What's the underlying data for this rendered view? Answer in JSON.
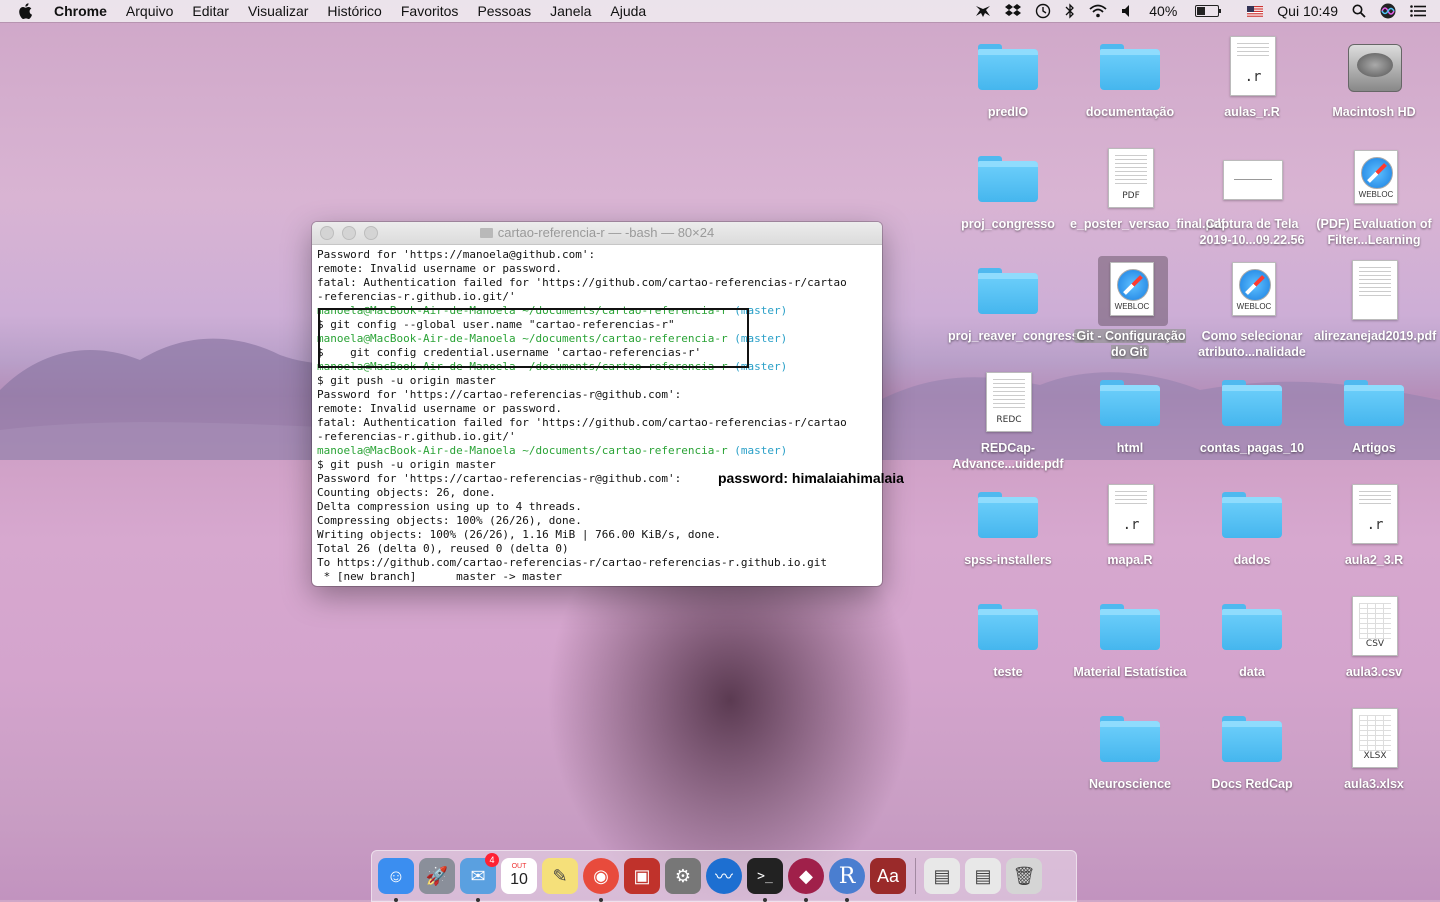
{
  "menubar": {
    "app": "Chrome",
    "items": [
      "Arquivo",
      "Editar",
      "Visualizar",
      "Histórico",
      "Favoritos",
      "Pessoas",
      "Janela",
      "Ajuda"
    ],
    "battery_percent": "40%",
    "battery_level": 0.4,
    "clock": "Qui 10:49"
  },
  "desktop": {
    "icons": [
      {
        "label": "predIO",
        "type": "folder"
      },
      {
        "label": "documentação",
        "type": "folder"
      },
      {
        "label": "aulas_r.R",
        "type": "r-file",
        "ext": ".r"
      },
      {
        "label": "Macintosh HD",
        "type": "drive"
      },
      {
        "label": "proj_congresso",
        "type": "folder"
      },
      {
        "label": "e_poster_versao_final.pdf",
        "type": "pdf",
        "ext": "PDF"
      },
      {
        "label": "Captura de Tela 2019-10...09.22.56",
        "type": "image"
      },
      {
        "label": "(PDF) Evaluation of Filter...Learning",
        "type": "webloc",
        "ext": "WEBLOC"
      },
      {
        "label": "proj_reaver_congresso",
        "type": "folder"
      },
      {
        "label": "Git - Configuração do Git",
        "type": "webloc",
        "ext": "WEBLOC"
      },
      {
        "label": "Como selecionar atributo...nalidade",
        "type": "webloc",
        "ext": "WEBLOC"
      },
      {
        "label": "alirezanejad2019.pdf",
        "type": "pdf"
      },
      {
        "label": "REDCap-Advance...uide.pdf",
        "type": "pdf",
        "ext": "REDC"
      },
      {
        "label": "html",
        "type": "folder"
      },
      {
        "label": "contas_pagas_10",
        "type": "folder"
      },
      {
        "label": "Artigos",
        "type": "folder"
      },
      {
        "label": "spss-installers",
        "type": "folder"
      },
      {
        "label": "mapa.R",
        "type": "r-file",
        "ext": ".r"
      },
      {
        "label": "dados",
        "type": "folder"
      },
      {
        "label": "aula2_3.R",
        "type": "r-file",
        "ext": ".r"
      },
      {
        "label": "teste",
        "type": "folder"
      },
      {
        "label": "Material Estatística",
        "type": "folder"
      },
      {
        "label": "data",
        "type": "folder"
      },
      {
        "label": "aula3.csv",
        "type": "csv",
        "ext": "CSV"
      },
      {
        "label": "Neuroscience",
        "type": "folder"
      },
      {
        "label": "Docs RedCap",
        "type": "folder"
      },
      {
        "label": "aula3.xlsx",
        "type": "xlsx",
        "ext": "XLSX"
      }
    ]
  },
  "terminal": {
    "title": "cartao-referencia-r — -bash — 80×24",
    "lines": [
      {
        "text": "Password for 'https://manoela@github.com':",
        "style": ""
      },
      {
        "text": "remote: Invalid username or password.",
        "style": ""
      },
      {
        "text": "fatal: Authentication failed for 'https://github.com/cartao-referencias-r/cartao",
        "style": ""
      },
      {
        "text": "-referencias-r.github.io.git/'",
        "style": ""
      },
      {
        "text": "manoela@MacBook-Air-de-Manoela ~/documents/cartao-referencia-r (master)",
        "style": "prompt"
      },
      {
        "text": "$ git config --global user.name \"cartao-referencias-r\"",
        "style": ""
      },
      {
        "text": "manoela@MacBook-Air-de-Manoela ~/documents/cartao-referencia-r (master)",
        "style": "prompt"
      },
      {
        "text": "$    git config credential.username 'cartao-referencias-r'",
        "style": ""
      },
      {
        "text": "manoela@MacBook-Air-de-Manoela ~/documents/cartao-referencia-r (master)",
        "style": "prompt"
      },
      {
        "text": "$ git push -u origin master",
        "style": ""
      },
      {
        "text": "Password for 'https://cartao-referencias-r@github.com':",
        "style": ""
      },
      {
        "text": "remote: Invalid username or password.",
        "style": ""
      },
      {
        "text": "fatal: Authentication failed for 'https://github.com/cartao-referencias-r/cartao",
        "style": ""
      },
      {
        "text": "-referencias-r.github.io.git/'",
        "style": ""
      },
      {
        "text": "manoela@MacBook-Air-de-Manoela ~/documents/cartao-referencia-r (master)",
        "style": "prompt"
      },
      {
        "text": "$ git push -u origin master",
        "style": ""
      },
      {
        "text": "Password for 'https://cartao-referencias-r@github.com':",
        "style": ""
      },
      {
        "text": "Counting objects: 26, done.",
        "style": ""
      },
      {
        "text": "Delta compression using up to 4 threads.",
        "style": ""
      },
      {
        "text": "Compressing objects: 100% (26/26), done.",
        "style": ""
      },
      {
        "text": "Writing objects: 100% (26/26), 1.16 MiB | 766.00 KiB/s, done.",
        "style": ""
      },
      {
        "text": "Total 26 (delta 0), reused 0 (delta 0)",
        "style": ""
      },
      {
        "text": "To https://github.com/cartao-referencias-r/cartao-referencias-r.github.io.git",
        "style": ""
      },
      {
        "text": " * [new branch]      master -> master",
        "style": ""
      }
    ],
    "annotation": "password: himalaiahimalaia"
  },
  "dock": {
    "items": [
      {
        "name": "finder",
        "glyph": "☺",
        "color": "#3b8ef0",
        "running": true
      },
      {
        "name": "launchpad",
        "glyph": "🚀",
        "color": "#8a8f9a",
        "running": false
      },
      {
        "name": "mail",
        "glyph": "✉",
        "color": "#5aa0e0",
        "running": true,
        "badge": "4"
      },
      {
        "name": "calendar",
        "glyph": "10",
        "color": "#ffffff",
        "running": false,
        "calendar_month": "OUT"
      },
      {
        "name": "stickies",
        "glyph": "✎",
        "color": "#f5e07a",
        "running": false
      },
      {
        "name": "chrome",
        "glyph": "◉",
        "color": "#e84b3c",
        "running": true
      },
      {
        "name": "photo-booth",
        "glyph": "▣",
        "color": "#c0322b",
        "running": false
      },
      {
        "name": "system-preferences",
        "glyph": "⚙",
        "color": "#777777",
        "running": false
      },
      {
        "name": "openoffice",
        "glyph": "〰",
        "color": "#1d6fd1",
        "running": false
      },
      {
        "name": "terminal",
        "glyph": ">_",
        "color": "#222222",
        "running": true
      },
      {
        "name": "rar",
        "glyph": "◆",
        "color": "#a0204a",
        "running": true
      },
      {
        "name": "r-app",
        "glyph": "R",
        "color": "#4a7ed0",
        "running": true
      },
      {
        "name": "dictionary",
        "glyph": "Aa",
        "color": "#9a2a2a",
        "running": false
      },
      {
        "name": "document-stack-r",
        "glyph": "▤",
        "color": "#e8e8e8",
        "running": false
      },
      {
        "name": "document-stack-chrome",
        "glyph": "▤",
        "color": "#e8e8e8",
        "running": false
      },
      {
        "name": "trash",
        "glyph": "🗑",
        "color": "#d5d5d5",
        "running": false
      }
    ]
  }
}
